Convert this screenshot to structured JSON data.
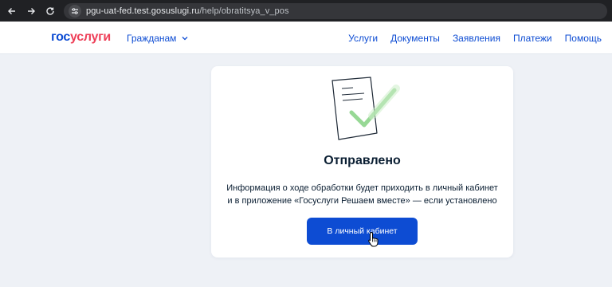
{
  "browser": {
    "url_host": "pgu-uat-fed.test.gosuslugi.ru",
    "url_path": "/help/obratitsya_v_pos"
  },
  "header": {
    "logo_part1": "гос",
    "logo_part2": "услуги",
    "audience_label": "Гражданам",
    "nav": [
      "Услуги",
      "Документы",
      "Заявления",
      "Платежи",
      "Помощь"
    ]
  },
  "card": {
    "title": "Отправлено",
    "text_line1": "Информация о ходе обработки будет приходить в личный кабинет",
    "text_line2": "и в приложение «Госуслуги Решаем вместе» — если установлено",
    "button_label": "В личный кабинет"
  },
  "colors": {
    "brand_blue": "#0d4cd3",
    "brand_red": "#ee3f58",
    "check_green": "#8cd48a",
    "page_bg": "#eef1f6"
  },
  "icons": [
    "back-arrow-icon",
    "forward-arrow-icon",
    "reload-icon",
    "site-settings-icon",
    "chevron-down-icon",
    "document-check-illustration",
    "hand-pointer-icon"
  ]
}
